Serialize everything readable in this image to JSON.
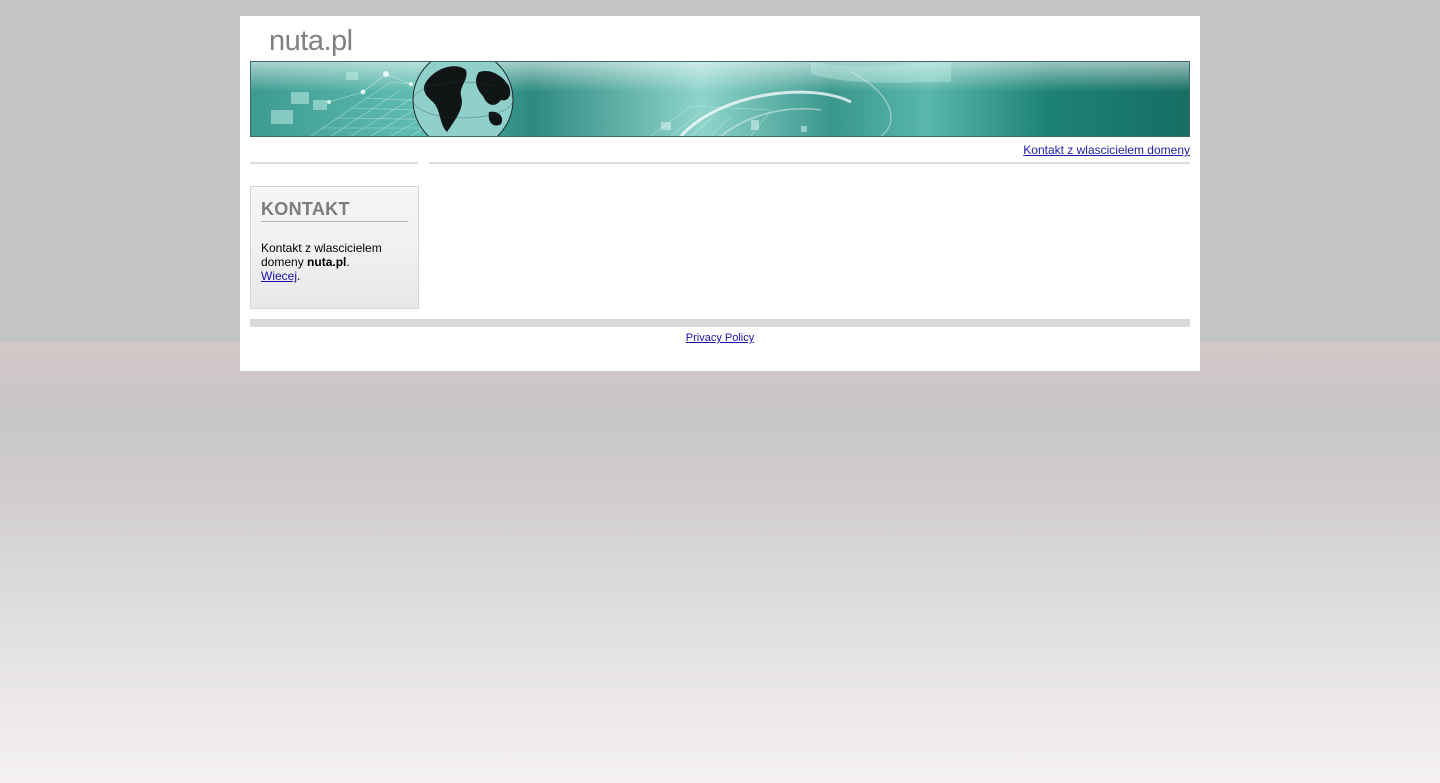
{
  "header": {
    "site_title": "nuta.pl"
  },
  "banner": {
    "description_icon": "globe-banner-image"
  },
  "topnav": {
    "contact_link": "Kontakt z wlascicielem domeny"
  },
  "sidebar": {
    "box_title": "KONTAKT",
    "text_before": "Kontakt z wlascicielem domeny ",
    "domain": "nuta.pl",
    "text_after": ".",
    "more_link": "Wiecej",
    "more_suffix": "."
  },
  "footer": {
    "privacy_link": "Privacy Policy"
  },
  "colors": {
    "accent_link": "#1a0dab",
    "banner_teal": "#2e8a80",
    "title_gray": "#808080"
  }
}
